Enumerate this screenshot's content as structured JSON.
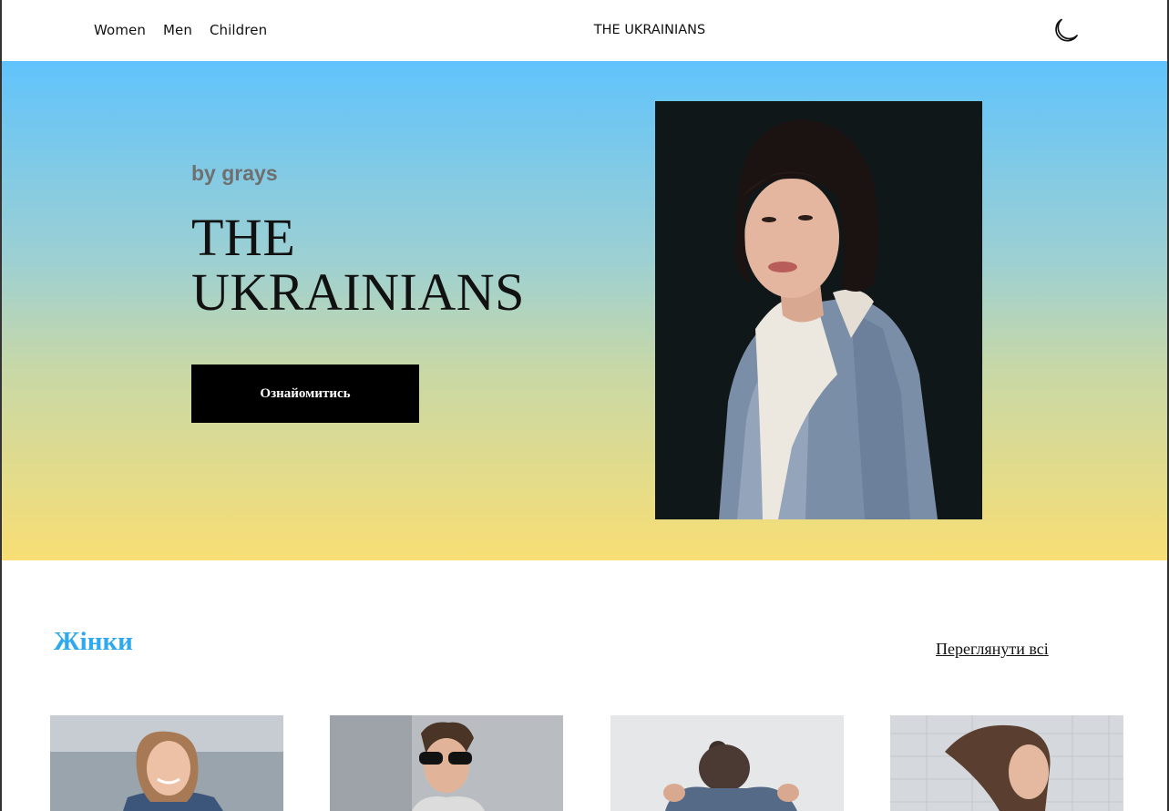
{
  "header": {
    "nav": [
      {
        "label": "Women"
      },
      {
        "label": "Men"
      },
      {
        "label": "Children"
      }
    ],
    "brand": "THE UKRAINIANS",
    "theme_toggle_icon": "moon-icon"
  },
  "hero": {
    "byline": "by grays",
    "title": "THE UKRAINIANS",
    "cta_label": "Ознайомитись",
    "colors": {
      "top": "#60c3fc",
      "bottom": "#f8de74"
    }
  },
  "section": {
    "title": "Жінки",
    "view_all": "Переглянути всі",
    "accent": "#2ea9ee"
  }
}
